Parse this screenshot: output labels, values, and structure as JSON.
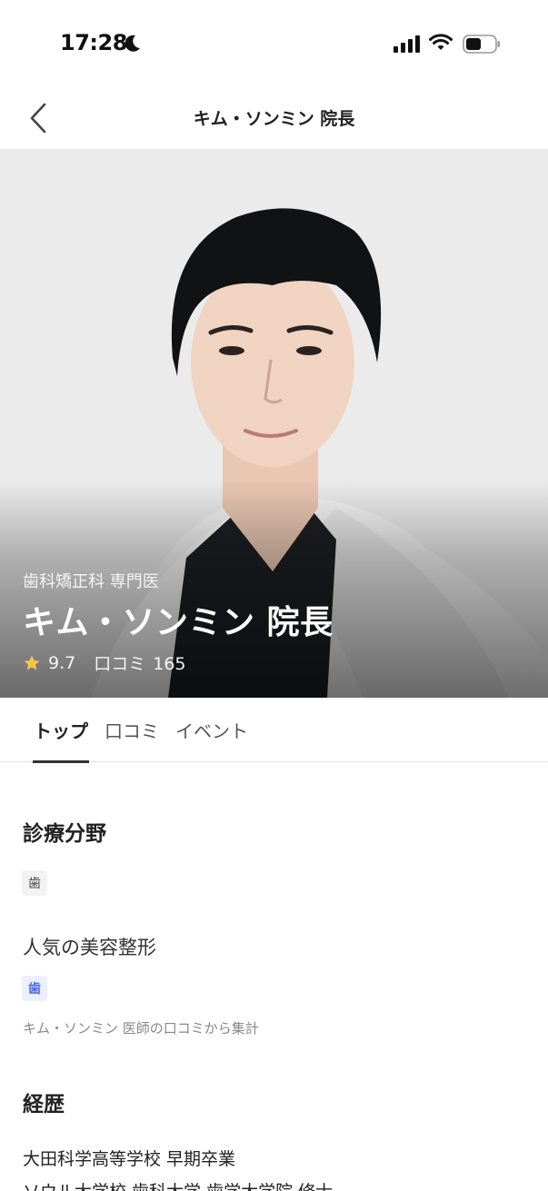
{
  "status_bar": {
    "time": "17:28"
  },
  "nav": {
    "title": "キム・ソンミン 院長"
  },
  "hero": {
    "specialty": "歯科矯正科 専門医",
    "name": "キム・ソンミン 院長",
    "rating": "9.7",
    "review_label": "口コミ",
    "review_count": "165"
  },
  "tabs": [
    {
      "label": "トップ",
      "active": true
    },
    {
      "label": "口コミ",
      "active": false
    },
    {
      "label": "イベント",
      "active": false
    }
  ],
  "sections": {
    "field_title": "診療分野",
    "field_chip": "歯",
    "popular_title": "人気の美容整形",
    "popular_chip": "歯",
    "popular_note": "キム・ソンミン 医師の口コミから集計",
    "career_title": "経歴",
    "career_items": [
      "大田科学高等学校 早期卒業",
      "ソウル大学校 歯科大学 歯学大学院 修士"
    ]
  },
  "colors": {
    "accent_blue": "#4a6de5",
    "star": "#f5c24c"
  }
}
